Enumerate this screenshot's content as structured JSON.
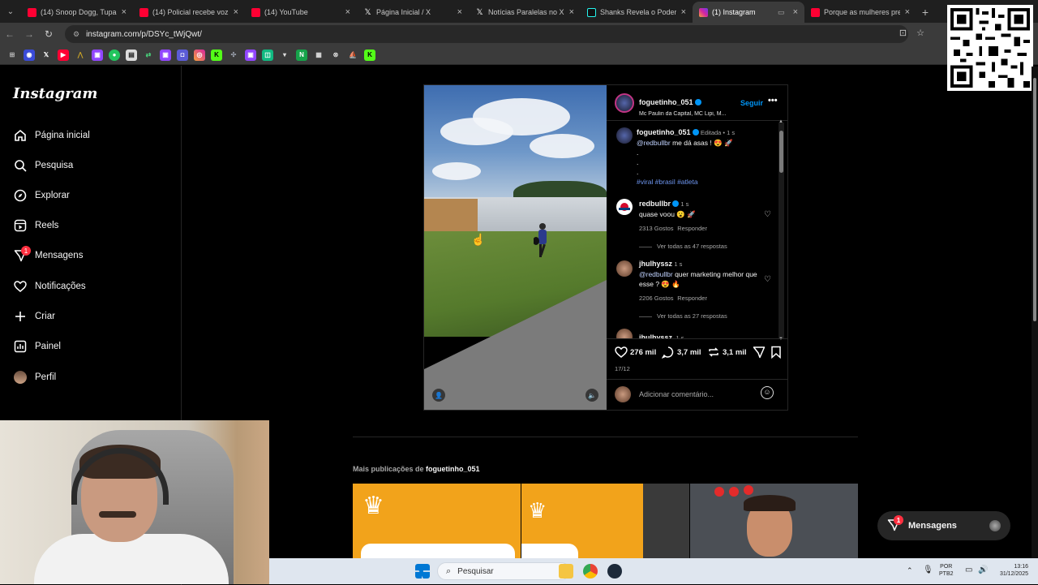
{
  "browser": {
    "tabs": [
      {
        "title": "(14) Snoop Dogg, Tupac,",
        "favicon": "youtube-icon",
        "active": false
      },
      {
        "title": "(14) Policial recebe voz de",
        "favicon": "youtube-icon",
        "active": false
      },
      {
        "title": "(14) YouTube",
        "favicon": "youtube-icon",
        "active": false
      },
      {
        "title": "Página Inicial / X",
        "favicon": "x-icon",
        "active": false
      },
      {
        "title": "Notícias Paralelas no X: \"",
        "favicon": "x-icon",
        "active": false
      },
      {
        "title": "Shanks Revela o Poder d",
        "favicon": "tiktok-icon",
        "active": false
      },
      {
        "title": "(1) Instagram",
        "favicon": "instagram-icon",
        "active": true
      },
      {
        "title": "Porque as mulheres pref",
        "favicon": "youtube-icon",
        "active": false
      }
    ],
    "url": "instagram.com/p/DSYc_tWjQwt/"
  },
  "instagram": {
    "logo": "Instagram",
    "nav": [
      {
        "label": "Página inicial",
        "icon": "home-icon"
      },
      {
        "label": "Pesquisa",
        "icon": "search-icon"
      },
      {
        "label": "Explorar",
        "icon": "compass-icon"
      },
      {
        "label": "Reels",
        "icon": "reels-icon"
      },
      {
        "label": "Mensagens",
        "icon": "messages-icon",
        "badge": "1"
      },
      {
        "label": "Notificações",
        "icon": "heart-icon"
      },
      {
        "label": "Criar",
        "icon": "plus-icon"
      },
      {
        "label": "Painel",
        "icon": "dashboard-icon"
      },
      {
        "label": "Perfil",
        "icon": "profile-avatar"
      }
    ],
    "post": {
      "author": "foguetinho_051",
      "audio": "Mc Paulin da Capital, MC Lipi, M...",
      "follow_label": "Seguir",
      "caption": {
        "author": "foguetinho_051",
        "edited": "Editada",
        "time": "1 s",
        "mention": "@redbullbr",
        "text": "me dá asas ! 😍 🚀",
        "dots": [
          ".",
          ".",
          "."
        ],
        "hashtags": "#viral #brasil #atleta"
      },
      "comments": [
        {
          "user": "redbullbr",
          "time": "1 s",
          "text": "quase voou 😮 🚀",
          "likes": "2313 Gostos",
          "reply": "Responder",
          "view_replies": "Ver todas as 47 respostas"
        },
        {
          "user": "jhulhyssz",
          "time": "1 s",
          "mention": "@redbullbr",
          "text": "quer marketing melhor que esse ? 😍 🔥",
          "likes": "2206 Gostos",
          "reply": "Responder",
          "view_replies": "Ver todas as 27 respostas"
        },
        {
          "user": "jhulhyssz",
          "time": "1 s"
        }
      ],
      "likes": "276 mil",
      "comments_count": "3,7 mil",
      "reposts": "3,1 mil",
      "date": "17/12",
      "add_comment_placeholder": "Adicionar comentário..."
    },
    "more_posts_prefix": "Mais publicações de",
    "more_posts_user": "foguetinho_051",
    "messages_pill": "Mensagens",
    "messages_badge": "1"
  },
  "taskbar": {
    "search_placeholder": "Pesquisar",
    "lang": "POR",
    "lang2": "PTB2",
    "time": "13:16",
    "date": "31/12/2025"
  }
}
